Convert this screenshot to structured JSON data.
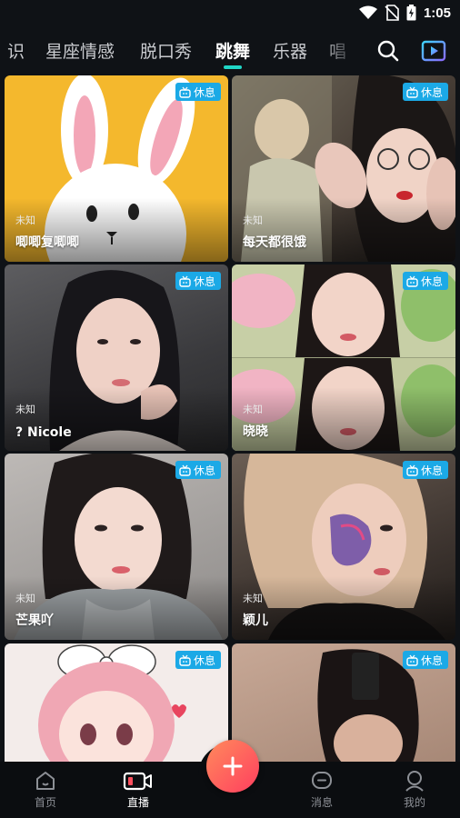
{
  "status_bar": {
    "time": "1:05"
  },
  "tabs": [
    {
      "label": "识",
      "active": false
    },
    {
      "label": "星座情感",
      "active": false
    },
    {
      "label": "脱口秀",
      "active": false
    },
    {
      "label": "跳舞",
      "active": true
    },
    {
      "label": "乐器",
      "active": false
    },
    {
      "label": "唱",
      "active": false
    }
  ],
  "cards": [
    {
      "badge": "休息",
      "state": "未知",
      "name": "唧唧复唧唧"
    },
    {
      "badge": "休息",
      "state": "未知",
      "name": "每天都很饿"
    },
    {
      "badge": "休息",
      "state": "未知",
      "name": "? Nicole"
    },
    {
      "badge": "休息",
      "state": "未知",
      "name": "晓晓"
    },
    {
      "badge": "休息",
      "state": "未知",
      "name": "芒果吖"
    },
    {
      "badge": "休息",
      "state": "未知",
      "name": "颖儿"
    },
    {
      "badge": "休息",
      "state": "",
      "name": ""
    },
    {
      "badge": "休息",
      "state": "",
      "name": ""
    }
  ],
  "bottom_nav": [
    {
      "label": "首页",
      "icon": "home-icon"
    },
    {
      "label": "直播",
      "icon": "live-icon",
      "active": true
    },
    {
      "label": "消息",
      "icon": "message-icon"
    },
    {
      "label": "我的",
      "icon": "profile-icon"
    }
  ],
  "colors": {
    "accent": "#20d6c6",
    "badge": "#1ba9e6",
    "fab": "#ff4f5e"
  }
}
